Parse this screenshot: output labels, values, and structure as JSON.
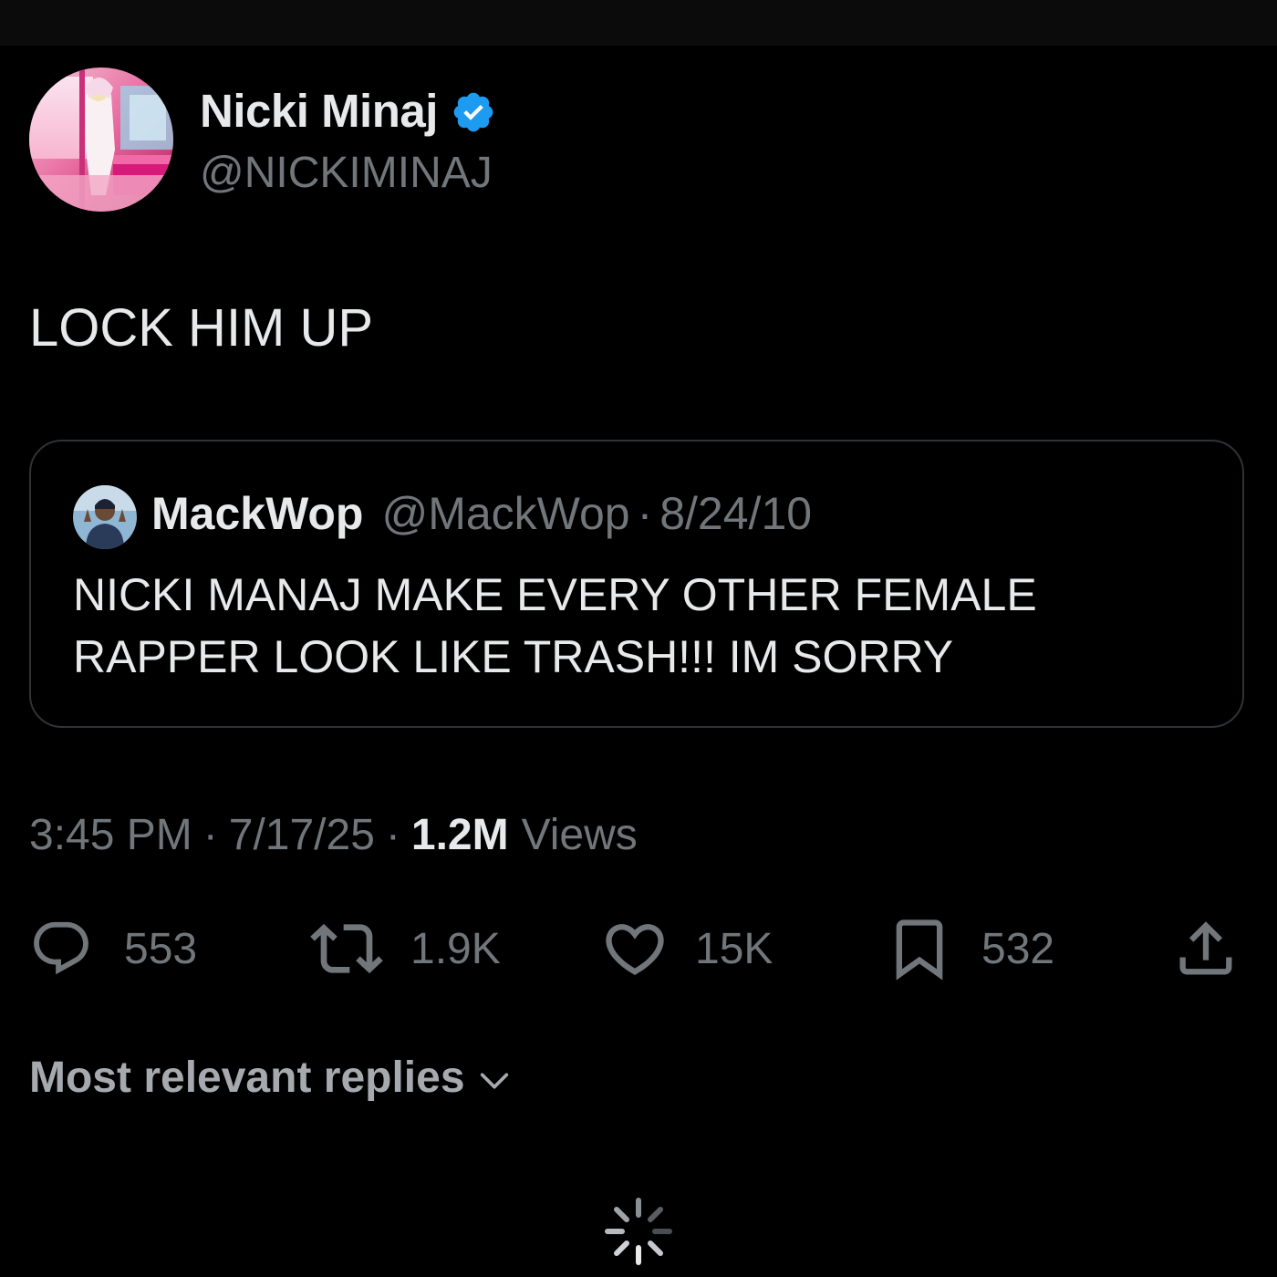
{
  "tweet": {
    "author": {
      "name": "Nicki Minaj",
      "handle": "@NICKIMINAJ",
      "verified": true,
      "avatar": "avatar"
    },
    "text": "LOCK HIM UP",
    "quoted": {
      "name": "MackWop",
      "handle": "@MackWop",
      "separator": "·",
      "date": "8/24/10",
      "text": "NICKI MANAJ MAKE EVERY OTHER FEMALE RAPPER LOOK LIKE TRASH!!! IM SORRY"
    },
    "meta": {
      "time": "3:45 PM",
      "date": "7/17/25",
      "separator": "·",
      "views_count": "1.2M",
      "views_label": "Views"
    },
    "actions": {
      "replies": "553",
      "reposts": "1.9K",
      "likes": "15K",
      "bookmarks": "532"
    }
  },
  "replies_sort": {
    "label": "Most relevant replies"
  },
  "colors": {
    "background": "#000000",
    "text_primary": "#e7e9ea",
    "text_secondary": "#71767b",
    "border": "#2f3336",
    "verified_blue": "#1d9bf0"
  },
  "icons": [
    "reply-icon",
    "repost-icon",
    "like-icon",
    "bookmark-icon",
    "share-icon",
    "verified-badge-icon",
    "chevron-down-icon",
    "loading-spinner-icon"
  ]
}
